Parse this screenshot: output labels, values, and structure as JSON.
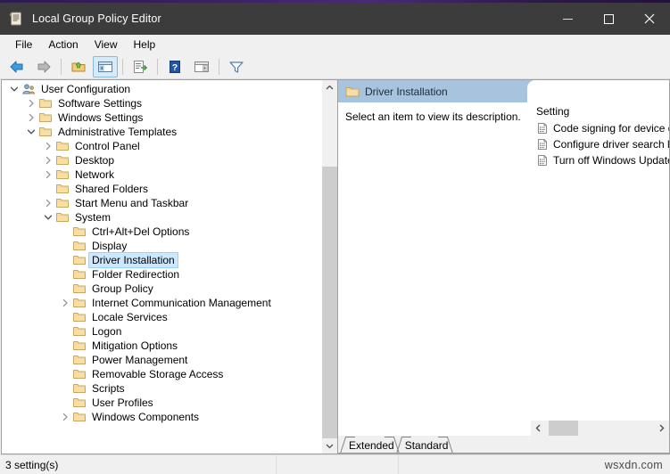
{
  "window": {
    "title": "Local Group Policy Editor",
    "icon": "policy-scroll-icon",
    "minimize_label": "Minimize",
    "maximize_label": "Maximize",
    "close_label": "Close"
  },
  "menubar": {
    "items": [
      {
        "label": "File"
      },
      {
        "label": "Action"
      },
      {
        "label": "View"
      },
      {
        "label": "Help"
      }
    ]
  },
  "toolbar": {
    "buttons": [
      {
        "name": "back-button",
        "icon": "back-arrow-icon",
        "active": false
      },
      {
        "name": "forward-button",
        "icon": "forward-arrow-icon",
        "active": false
      },
      {
        "name": "up-one-level-button",
        "icon": "up-folder-icon",
        "active": false
      },
      {
        "name": "show-hide-console-tree-button",
        "icon": "console-tree-icon",
        "active": true
      },
      {
        "name": "export-list-button",
        "icon": "export-list-icon",
        "active": false
      },
      {
        "name": "help-button",
        "icon": "help-question-icon",
        "active": false
      },
      {
        "name": "show-hide-action-pane-button",
        "icon": "action-pane-icon",
        "active": false
      },
      {
        "name": "filter-button",
        "icon": "filter-funnel-icon",
        "active": false
      }
    ]
  },
  "tree": {
    "nodes": [
      {
        "label": "User Configuration",
        "indent": 0,
        "twisty": "expanded",
        "icon": "user-configuration-icon",
        "selected": false
      },
      {
        "label": "Software Settings",
        "indent": 1,
        "twisty": "collapsed",
        "icon": "folder-icon",
        "selected": false
      },
      {
        "label": "Windows Settings",
        "indent": 1,
        "twisty": "collapsed",
        "icon": "folder-icon",
        "selected": false
      },
      {
        "label": "Administrative Templates",
        "indent": 1,
        "twisty": "expanded",
        "icon": "folder-icon",
        "selected": false
      },
      {
        "label": "Control Panel",
        "indent": 2,
        "twisty": "collapsed",
        "icon": "folder-icon",
        "selected": false
      },
      {
        "label": "Desktop",
        "indent": 2,
        "twisty": "collapsed",
        "icon": "folder-icon",
        "selected": false
      },
      {
        "label": "Network",
        "indent": 2,
        "twisty": "collapsed",
        "icon": "folder-icon",
        "selected": false
      },
      {
        "label": "Shared Folders",
        "indent": 2,
        "twisty": "none",
        "icon": "folder-icon",
        "selected": false
      },
      {
        "label": "Start Menu and Taskbar",
        "indent": 2,
        "twisty": "collapsed",
        "icon": "folder-icon",
        "selected": false
      },
      {
        "label": "System",
        "indent": 2,
        "twisty": "expanded",
        "icon": "folder-icon",
        "selected": false
      },
      {
        "label": "Ctrl+Alt+Del Options",
        "indent": 3,
        "twisty": "none",
        "icon": "folder-icon",
        "selected": false
      },
      {
        "label": "Display",
        "indent": 3,
        "twisty": "none",
        "icon": "folder-icon",
        "selected": false
      },
      {
        "label": "Driver Installation",
        "indent": 3,
        "twisty": "none",
        "icon": "folder-icon",
        "selected": true
      },
      {
        "label": "Folder Redirection",
        "indent": 3,
        "twisty": "none",
        "icon": "folder-icon",
        "selected": false
      },
      {
        "label": "Group Policy",
        "indent": 3,
        "twisty": "none",
        "icon": "folder-icon",
        "selected": false
      },
      {
        "label": "Internet Communication Management",
        "indent": 3,
        "twisty": "collapsed",
        "icon": "folder-icon",
        "selected": false
      },
      {
        "label": "Locale Services",
        "indent": 3,
        "twisty": "none",
        "icon": "folder-icon",
        "selected": false
      },
      {
        "label": "Logon",
        "indent": 3,
        "twisty": "none",
        "icon": "folder-icon",
        "selected": false
      },
      {
        "label": "Mitigation Options",
        "indent": 3,
        "twisty": "none",
        "icon": "folder-icon",
        "selected": false
      },
      {
        "label": "Power Management",
        "indent": 3,
        "twisty": "none",
        "icon": "folder-icon",
        "selected": false
      },
      {
        "label": "Removable Storage Access",
        "indent": 3,
        "twisty": "none",
        "icon": "folder-icon",
        "selected": false
      },
      {
        "label": "Scripts",
        "indent": 3,
        "twisty": "none",
        "icon": "folder-icon",
        "selected": false
      },
      {
        "label": "User Profiles",
        "indent": 3,
        "twisty": "none",
        "icon": "folder-icon",
        "selected": false
      },
      {
        "label": "Windows Components",
        "indent": 3,
        "twisty": "collapsed",
        "icon": "folder-icon",
        "selected": false
      }
    ]
  },
  "details": {
    "header_title": "Driver Installation",
    "header_icon": "folder-icon",
    "description": "Select an item to view its description.",
    "column_header": "Setting",
    "settings": [
      {
        "label": "Code signing for device drivers",
        "icon": "policy-setting-icon"
      },
      {
        "label": "Configure driver search locations",
        "icon": "policy-setting-icon"
      },
      {
        "label": "Turn off Windows Update device driver search prompt",
        "icon": "policy-setting-icon"
      }
    ]
  },
  "tabs": [
    {
      "label": "Extended",
      "selected": false
    },
    {
      "label": "Standard",
      "selected": true
    }
  ],
  "statusbar": {
    "left": "3 setting(s)",
    "middle": "",
    "watermark": "wsxdn.com"
  },
  "colors": {
    "titlebar_bg": "#3c3c3c",
    "chrome_bg": "#f0f0f0",
    "selection_blue": "#cce8ff",
    "details_header_blue": "#a7c3dd",
    "scrollbar_thumb": "#cdcdcd"
  }
}
